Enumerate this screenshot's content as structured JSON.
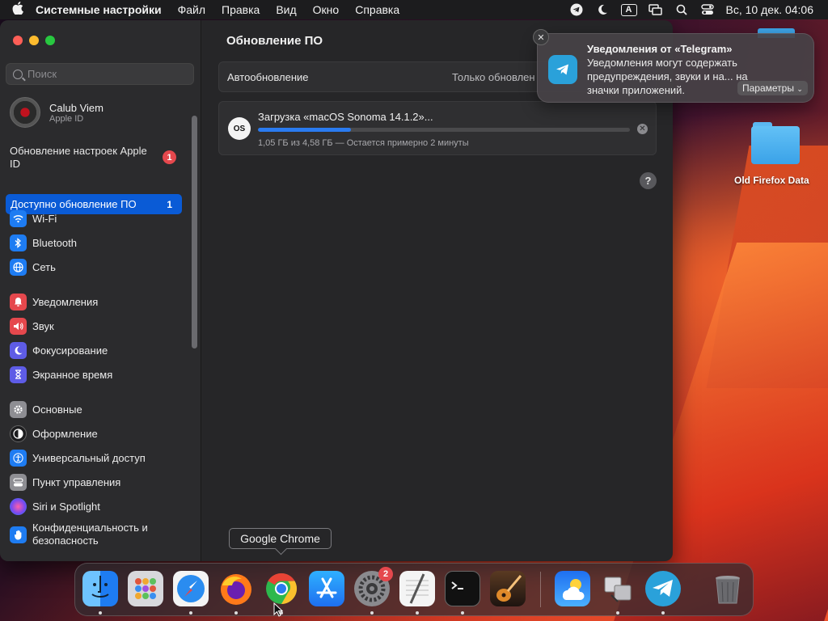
{
  "menubar": {
    "app_name": "Системные настройки",
    "menus": [
      "Файл",
      "Правка",
      "Вид",
      "Окно",
      "Справка"
    ],
    "input_indicator": "A",
    "clock": "Вс, 10 дек.  04:06"
  },
  "sidebar": {
    "search_placeholder": "Поиск",
    "account": {
      "name": "Calub Viem",
      "sub": "Apple ID"
    },
    "alert_item": {
      "label": "Обновление настроек Apple ID",
      "badge": "1"
    },
    "selected_item": {
      "label": "Доступно обновление ПО",
      "count": "1"
    },
    "group1": [
      {
        "label": "Wi-Fi",
        "icon": "wifi-icon",
        "color": "#1e7cf2"
      },
      {
        "label": "Bluetooth",
        "icon": "bluetooth-icon",
        "color": "#1e7cf2"
      },
      {
        "label": "Сеть",
        "icon": "network-globe-icon",
        "color": "#1e7cf2"
      }
    ],
    "group2": [
      {
        "label": "Уведомления",
        "icon": "notifications-bell-icon",
        "color": "#e5484d"
      },
      {
        "label": "Звук",
        "icon": "speaker-icon",
        "color": "#e5484d"
      },
      {
        "label": "Фокусирование",
        "icon": "moon-icon",
        "color": "#5e5ce6"
      },
      {
        "label": "Экранное время",
        "icon": "hourglass-icon",
        "color": "#5e5ce6"
      }
    ],
    "group3": [
      {
        "label": "Основные",
        "icon": "gear-icon",
        "color": "#8e8e93"
      },
      {
        "label": "Оформление",
        "icon": "appearance-icon",
        "color": "#1c1c1e"
      },
      {
        "label": "Универсальный доступ",
        "icon": "accessibility-icon",
        "color": "#1e7cf2"
      },
      {
        "label": "Пункт управления",
        "icon": "control-center-icon",
        "color": "#8e8e93"
      },
      {
        "label": "Siri и Spotlight",
        "icon": "siri-icon",
        "color": "#b04ad8"
      },
      {
        "label": "Конфиденциальность и безопасность",
        "icon": "privacy-hand-icon",
        "color": "#1e7cf2"
      }
    ]
  },
  "main": {
    "title": "Обновление ПО",
    "auto_update": {
      "label": "Автообновление",
      "value": "Только обновлен"
    },
    "download": {
      "os_badge": "OS",
      "title": "Загрузка «macOS Sonoma 14.1.2»...",
      "progress_percent": 25,
      "status": "1,05 ГБ из 4,58 ГБ — Остается примерно 2 минуты"
    },
    "help": "?"
  },
  "notification": {
    "title": "Уведомления от «Telegram»",
    "body": "Уведомления могут содержать предупреждения, звуки и на... на значки приложений.",
    "button": "Параметры"
  },
  "desktop": {
    "folder_label": "Old Firefox Data"
  },
  "dock": {
    "tooltip": "Google Chrome",
    "settings_badge": "2"
  }
}
